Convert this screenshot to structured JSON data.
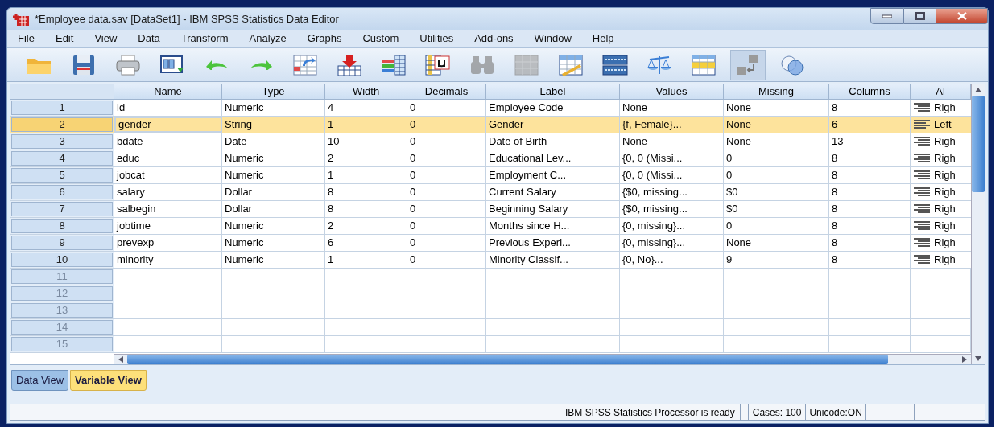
{
  "window": {
    "title": "*Employee data.sav [DataSet1] - IBM SPSS Statistics Data Editor"
  },
  "menu": [
    {
      "key": "F",
      "post": "ile"
    },
    {
      "key": "E",
      "post": "dit"
    },
    {
      "key": "V",
      "post": "iew"
    },
    {
      "key": "D",
      "post": "ata"
    },
    {
      "key": "T",
      "post": "ransform"
    },
    {
      "key": "A",
      "post": "nalyze"
    },
    {
      "key": "G",
      "post": "raphs"
    },
    {
      "key": "C",
      "post": "ustom"
    },
    {
      "key": "U",
      "post": "tilities"
    },
    {
      "pre": "Add-",
      "key": "o",
      "post": "ns"
    },
    {
      "key": "W",
      "post": "indow"
    },
    {
      "key": "H",
      "post": "elp"
    }
  ],
  "toolbar": [
    {
      "kind": "open",
      "disabled": false,
      "pressed": false
    },
    {
      "kind": "save",
      "disabled": false,
      "pressed": false
    },
    {
      "kind": "print",
      "disabled": false,
      "pressed": false
    },
    {
      "kind": "recall",
      "disabled": false,
      "pressed": false
    },
    {
      "kind": "undo",
      "disabled": false,
      "pressed": false
    },
    {
      "kind": "redo",
      "disabled": false,
      "pressed": false
    },
    {
      "kind": "goto-case",
      "disabled": false,
      "pressed": false
    },
    {
      "kind": "goto-variable",
      "disabled": false,
      "pressed": false
    },
    {
      "kind": "variables",
      "disabled": false,
      "pressed": false
    },
    {
      "kind": "descriptives",
      "disabled": false,
      "pressed": false
    },
    {
      "kind": "find",
      "disabled": true,
      "pressed": false
    },
    {
      "kind": "insert-cases",
      "disabled": true,
      "pressed": false
    },
    {
      "kind": "insert-variable",
      "disabled": false,
      "pressed": false
    },
    {
      "kind": "split",
      "disabled": false,
      "pressed": false
    },
    {
      "kind": "weight",
      "disabled": false,
      "pressed": false
    },
    {
      "kind": "select",
      "disabled": false,
      "pressed": false
    },
    {
      "kind": "value-labels",
      "disabled": false,
      "pressed": true
    },
    {
      "kind": "sets",
      "disabled": false,
      "pressed": false
    }
  ],
  "table": {
    "columns": [
      "Name",
      "Type",
      "Width",
      "Decimals",
      "Label",
      "Values",
      "Missing",
      "Columns",
      "Al"
    ],
    "rows": [
      {
        "number": "1",
        "selected": false,
        "focused": false,
        "cells": [
          "id",
          "Numeric",
          "4",
          "0",
          "Employee Code",
          "None",
          "None",
          "8"
        ],
        "align": {
          "kind": "right",
          "text": "Righ"
        }
      },
      {
        "number": "2",
        "selected": true,
        "focused": true,
        "cells": [
          "gender",
          "String",
          "1",
          "0",
          "Gender",
          "{f, Female}...",
          "None",
          "6"
        ],
        "align": {
          "kind": "left",
          "text": "Left"
        }
      },
      {
        "number": "3",
        "selected": false,
        "focused": false,
        "cells": [
          "bdate",
          "Date",
          "10",
          "0",
          "Date of Birth",
          "None",
          "None",
          "13"
        ],
        "align": {
          "kind": "right",
          "text": "Righ"
        }
      },
      {
        "number": "4",
        "selected": false,
        "focused": false,
        "cells": [
          "educ",
          "Numeric",
          "2",
          "0",
          "Educational Lev...",
          "{0, 0 (Missi...",
          "0",
          "8"
        ],
        "align": {
          "kind": "right",
          "text": "Righ"
        }
      },
      {
        "number": "5",
        "selected": false,
        "focused": false,
        "cells": [
          "jobcat",
          "Numeric",
          "1",
          "0",
          "Employment C...",
          "{0, 0 (Missi...",
          "0",
          "8"
        ],
        "align": {
          "kind": "right",
          "text": "Righ"
        }
      },
      {
        "number": "6",
        "selected": false,
        "focused": false,
        "cells": [
          "salary",
          "Dollar",
          "8",
          "0",
          "Current Salary",
          "{$0, missing...",
          "$0",
          "8"
        ],
        "align": {
          "kind": "right",
          "text": "Righ"
        }
      },
      {
        "number": "7",
        "selected": false,
        "focused": false,
        "cells": [
          "salbegin",
          "Dollar",
          "8",
          "0",
          "Beginning Salary",
          "{$0, missing...",
          "$0",
          "8"
        ],
        "align": {
          "kind": "right",
          "text": "Righ"
        }
      },
      {
        "number": "8",
        "selected": false,
        "focused": false,
        "cells": [
          "jobtime",
          "Numeric",
          "2",
          "0",
          "Months since H...",
          "{0, missing}...",
          "0",
          "8"
        ],
        "align": {
          "kind": "right",
          "text": "Righ"
        }
      },
      {
        "number": "9",
        "selected": false,
        "focused": false,
        "cells": [
          "prevexp",
          "Numeric",
          "6",
          "0",
          "Previous Experi...",
          "{0, missing}...",
          "None",
          "8"
        ],
        "align": {
          "kind": "right",
          "text": "Righ"
        }
      },
      {
        "number": "10",
        "selected": false,
        "focused": false,
        "cells": [
          "minority",
          "Numeric",
          "1",
          "0",
          "Minority Classif...",
          "{0, No}...",
          "9",
          "8"
        ],
        "align": {
          "kind": "right",
          "text": "Righ"
        }
      },
      {
        "number": "11",
        "selected": false
      },
      {
        "number": "12",
        "selected": false
      },
      {
        "number": "13",
        "selected": false
      },
      {
        "number": "14",
        "selected": false
      },
      {
        "number": "15",
        "selected": false
      }
    ]
  },
  "tabs": [
    {
      "label": "Data View",
      "selected": false
    },
    {
      "label": "Variable View",
      "selected": true
    }
  ],
  "status_bar": [
    "IBM SPSS Statistics Processor is ready",
    "Cases: 100",
    "Unicode:ON"
  ]
}
